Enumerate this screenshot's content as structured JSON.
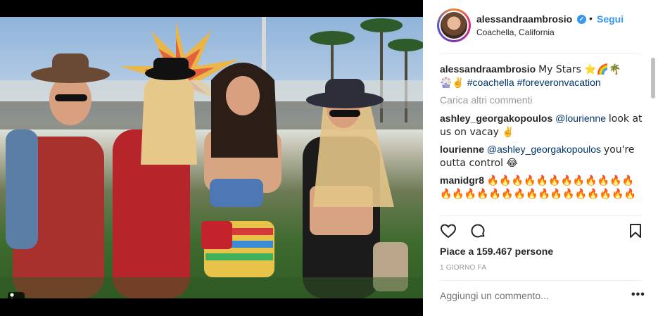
{
  "post": {
    "username": "alessandraambrosio",
    "verified_glyph": "✓",
    "separator": "•",
    "follow_label": "Segui",
    "location": "Coachella, California"
  },
  "comments": {
    "caption": {
      "user": "alessandraambrosio",
      "text": "My Stars ⭐🌈🌴",
      "text2": "🎡✌️",
      "tags": [
        "#coachella",
        "#foreveronvacation"
      ]
    },
    "load_more": "Carica altri commenti",
    "items": [
      {
        "user": "ashley_georgakopoulos",
        "mention": "@lourienne",
        "text": "look at us on vacay ✌️"
      },
      {
        "user": "lourienne",
        "mention": "@ashley_georgakopoulos",
        "text": "you're outta control 😂"
      },
      {
        "user": "manidgr8",
        "mention": "",
        "text": "🔥🔥🔥🔥🔥🔥🔥🔥🔥🔥🔥🔥🔥🔥🔥🔥🔥🔥🔥🔥🔥🔥🔥🔥🔥🔥🔥🔥"
      }
    ]
  },
  "actions": {
    "like_icon": "heart-icon",
    "comment_icon": "comment-icon",
    "save_icon": "bookmark-icon"
  },
  "likes_text": "Piace a 159.467 persone",
  "time_text": "1 GIORNO FA",
  "add_comment_placeholder": "Aggiungi un commento...",
  "more_options": "•••",
  "colors": {
    "link": "#3897f0",
    "text": "#262626",
    "muted": "#999999",
    "hashtag": "#003569"
  }
}
